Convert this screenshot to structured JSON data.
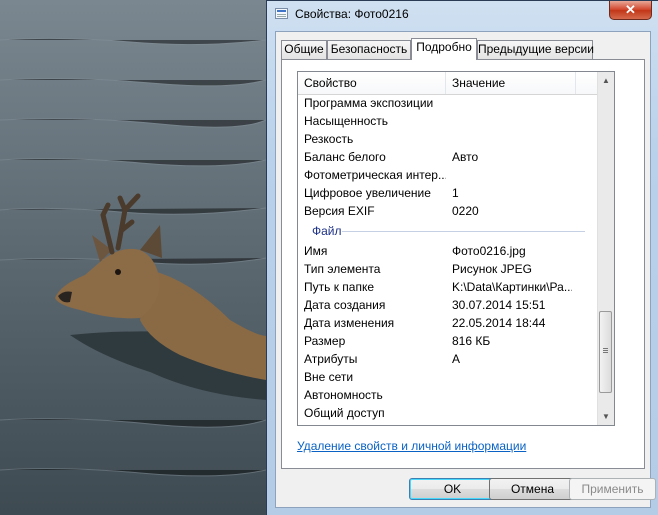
{
  "window": {
    "title": "Свойства: Фото0216",
    "close_symbol": "✕"
  },
  "tabs": [
    {
      "label": "Общие",
      "active": false
    },
    {
      "label": "Безопасность",
      "active": false
    },
    {
      "label": "Подробно",
      "active": true
    },
    {
      "label": "Предыдущие версии",
      "active": false
    }
  ],
  "list": {
    "header": {
      "property": "Свойство",
      "value": "Значение"
    },
    "rows_top": [
      {
        "name": "Программа экспозиции",
        "value": ""
      },
      {
        "name": "Насыщенность",
        "value": ""
      },
      {
        "name": "Резкость",
        "value": ""
      },
      {
        "name": "Баланс белого",
        "value": "Авто"
      },
      {
        "name": "Фотометрическая интер...",
        "value": ""
      },
      {
        "name": "Цифровое увеличение",
        "value": "1"
      },
      {
        "name": "Версия EXIF",
        "value": "0220"
      }
    ],
    "group": "Файл",
    "rows_file": [
      {
        "name": "Имя",
        "value": "Фото0216.jpg"
      },
      {
        "name": "Тип элемента",
        "value": "Рисунок JPEG"
      },
      {
        "name": "Путь к папке",
        "value": "K:\\Data\\Картинки\\Ра..."
      },
      {
        "name": "Дата создания",
        "value": "30.07.2014 15:51"
      },
      {
        "name": "Дата изменения",
        "value": "22.05.2014 18:44"
      },
      {
        "name": "Размер",
        "value": "816 КБ"
      },
      {
        "name": "Атрибуты",
        "value": "A"
      },
      {
        "name": "Вне сети",
        "value": ""
      },
      {
        "name": "Автономность",
        "value": ""
      },
      {
        "name": "Общий доступ",
        "value": ""
      }
    ],
    "scrollbar": {
      "up_icon": "▲",
      "down_icon": "▼"
    }
  },
  "remove_link": "Удаление свойств и личной информации",
  "buttons": {
    "ok": "OK",
    "cancel": "Отмена",
    "apply": "Применить"
  },
  "colors": {
    "accent_link": "#0a62c4",
    "group_header": "#1e3287"
  }
}
